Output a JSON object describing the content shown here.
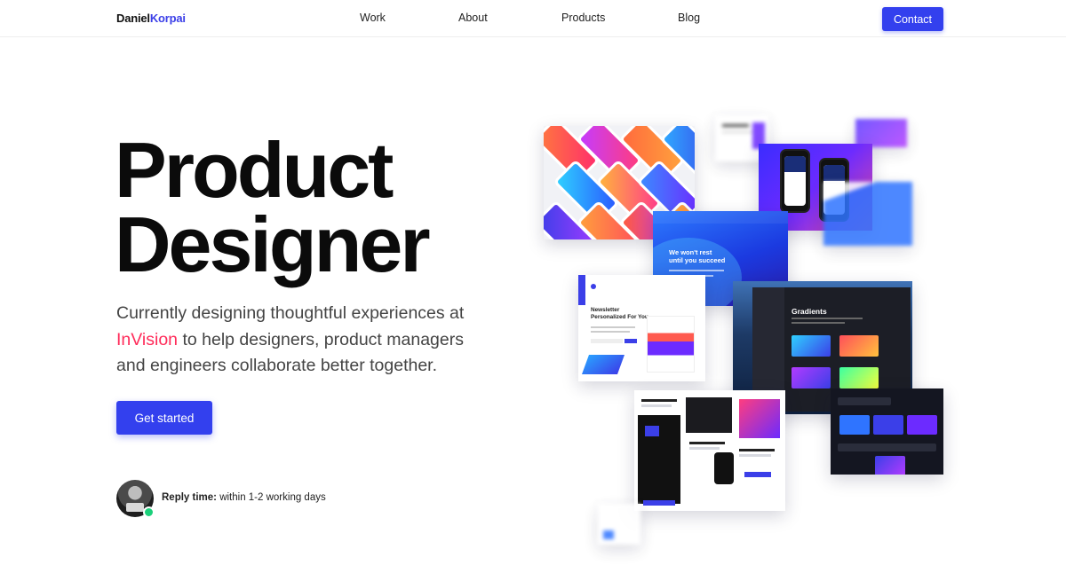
{
  "nav": {
    "logo_first": "Daniel",
    "logo_last": "Korpai",
    "links": [
      "Work",
      "About",
      "Products",
      "Blog"
    ],
    "contact_label": "Contact"
  },
  "hero": {
    "title_line1": "Product",
    "title_line2": "Designer",
    "desc_before": "Currently designing thoughtful experiences at ",
    "desc_brand": "InVision",
    "desc_after": " to help designers, product managers and engineers collaborate better together.",
    "cta_label": "Get started",
    "reply_label": "Reply time:",
    "reply_value": " within 1-2 working days"
  },
  "collage": {
    "blue_card_text_1": "We won't rest",
    "blue_card_text_2": "until you succeed",
    "news_card_text_1": "Newsletter",
    "news_card_text_2": "Personalized For You",
    "gradients_card_title": "Gradients"
  },
  "colors": {
    "accent": "#3340ee",
    "logo_last": "#3b3fe8",
    "brand_highlight": "#ff2c5a",
    "online": "#1bd07a"
  }
}
